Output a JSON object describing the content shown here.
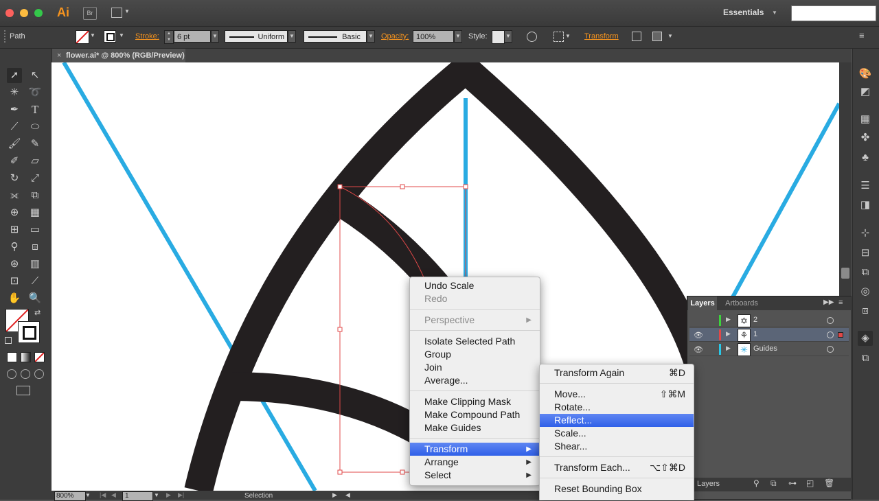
{
  "app": {
    "name": "Ai",
    "bridge": "Br",
    "workspace": "Essentials",
    "search": ""
  },
  "control": {
    "selection_type": "Path",
    "stroke_label": "Stroke:",
    "stroke_value": "6 pt",
    "profile": "Uniform",
    "brush": "Basic",
    "opacity_label": "Opacity:",
    "opacity_value": "100%",
    "style_label": "Style:",
    "transform_label": "Transform"
  },
  "document": {
    "tab": "flower.ai* @ 800% (RGB/Preview)"
  },
  "status": {
    "zoom": "800%",
    "artboard": "1",
    "mode": "Selection"
  },
  "layers": {
    "tabs": [
      "Layers",
      "Artboards"
    ],
    "items": [
      {
        "name": "2",
        "color": "#3cd23c"
      },
      {
        "name": "1",
        "color": "#e04848"
      },
      {
        "name": "Guides",
        "color": "#29c8e8"
      }
    ],
    "footer": "Layers"
  },
  "context_menu": {
    "undo": "Undo Scale",
    "redo": "Redo",
    "perspective": "Perspective",
    "isolate": "Isolate Selected Path",
    "group": "Group",
    "join": "Join",
    "average": "Average...",
    "clip": "Make Clipping Mask",
    "compound": "Make Compound Path",
    "guides": "Make Guides",
    "transform": "Transform",
    "arrange": "Arrange",
    "select": "Select"
  },
  "transform_menu": {
    "again": "Transform Again",
    "again_sc": "⌘D",
    "move": "Move...",
    "move_sc": "⇧⌘M",
    "rotate": "Rotate...",
    "reflect": "Reflect...",
    "scale": "Scale...",
    "shear": "Shear...",
    "each": "Transform Each...",
    "each_sc": "⌥⇧⌘D",
    "reset": "Reset Bounding Box"
  },
  "colors": {
    "accent": "#f7941e",
    "guide": "#29abe2",
    "path": "#231f20",
    "highlight": "#2f60e8"
  }
}
